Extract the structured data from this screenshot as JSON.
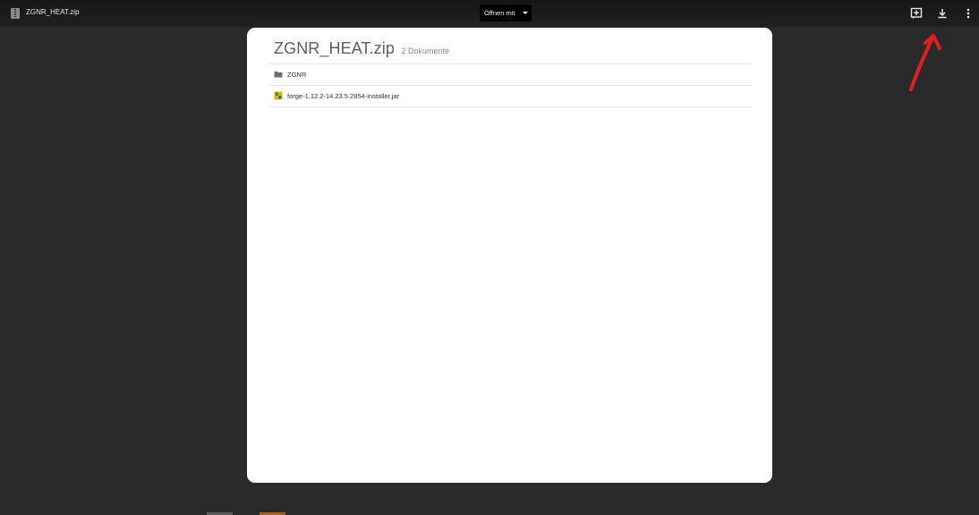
{
  "topbar": {
    "title": "ZGNR_HEAT.zip",
    "open_with_label": "Öffnen mit",
    "icons": [
      "file-icon",
      "add-comment-icon",
      "download-icon",
      "more-vert-icon"
    ]
  },
  "viewer": {
    "zip_name": "ZGNR_HEAT.zip",
    "doc_count": "2 Dokumente",
    "items": [
      {
        "label": "ZGNR",
        "icon": "folder-icon"
      },
      {
        "label": "forge-1.12.2-14.23.5.2854-installer.jar",
        "icon": "jar-file-icon"
      }
    ]
  },
  "annotation": {
    "type": "red-arrow",
    "points_to": "download-icon",
    "color": "#e02020"
  },
  "colors": {
    "background": "#2a2a2a",
    "topbar": "#1c1c1c",
    "viewer": "#ffffff"
  }
}
